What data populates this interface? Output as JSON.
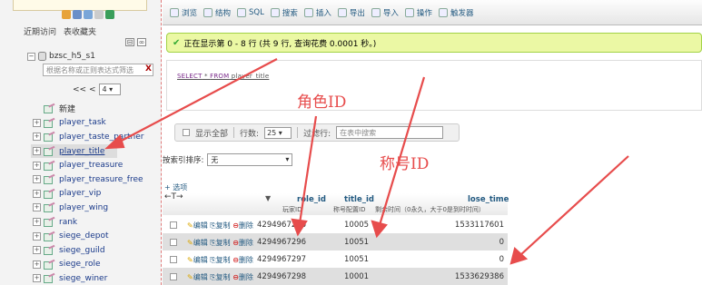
{
  "nav": {
    "tabs": [
      "近期访问",
      "表收藏夹"
    ],
    "collapse": [
      "⊟",
      "∞"
    ],
    "db_name": "bzsc_h5_s1",
    "filter_placeholder": "根据名称或正则表达式筛选",
    "filter_clear": "X",
    "pager_arrows": "<< <",
    "page_value": "4",
    "tree": [
      {
        "label": "新建",
        "new": true
      },
      {
        "label": "player_task"
      },
      {
        "label": "player_taste_partner"
      },
      {
        "label": "player_title",
        "selected": true
      },
      {
        "label": "player_treasure"
      },
      {
        "label": "player_treasure_free"
      },
      {
        "label": "player_vip"
      },
      {
        "label": "player_wing"
      },
      {
        "label": "rank"
      },
      {
        "label": "siege_depot"
      },
      {
        "label": "siege_guild"
      },
      {
        "label": "siege_role"
      },
      {
        "label": "siege_winer"
      }
    ]
  },
  "toolbar": {
    "items": [
      "浏览",
      "结构",
      "SQL",
      "搜索",
      "插入",
      "导出",
      "导入",
      "操作",
      "触发器"
    ]
  },
  "success_msg": "正在显示第 0 - 8 行 (共 9 行, 查询花费 0.0001 秒。)",
  "sql": {
    "select": "SELECT",
    "rest": " * ",
    "from": "FROM",
    "table": " player_title"
  },
  "options_bar": {
    "show_all": "显示全部",
    "rows_label": "行数:",
    "rows_value": "25",
    "filter_label": "过滤行:",
    "filter_placeholder": "在表中搜索"
  },
  "sort": {
    "label": "按索引排序:",
    "value": "无"
  },
  "options_link": "+ 选项",
  "col_arrows": "←T→",
  "col_dropdown": "▼",
  "columns": {
    "role_id": {
      "name": "role_id",
      "comment": "玩家ID"
    },
    "title_id": {
      "name": "title_id",
      "comment": "称号配置ID"
    },
    "lose_time": {
      "name": "lose_time",
      "comment": "剩余时间（0永久，大于0是到时时间）"
    }
  },
  "row_actions": {
    "edit": "编辑",
    "copy": "复制",
    "delete": "删除"
  },
  "rows": [
    {
      "role_id": "4294967296",
      "title_id": "10005",
      "lose_time": "1533117601"
    },
    {
      "role_id": "4294967296",
      "title_id": "10051",
      "lose_time": "0"
    },
    {
      "role_id": "4294967297",
      "title_id": "10051",
      "lose_time": "0"
    },
    {
      "role_id": "4294967298",
      "title_id": "10001",
      "lose_time": "1533629386"
    }
  ],
  "annotations": {
    "role_label": "角色ID",
    "title_label": "称号ID"
  },
  "colors": {
    "annotation": "#e74c4c",
    "success_bg": "#ebf8a4",
    "link": "#235a81"
  }
}
